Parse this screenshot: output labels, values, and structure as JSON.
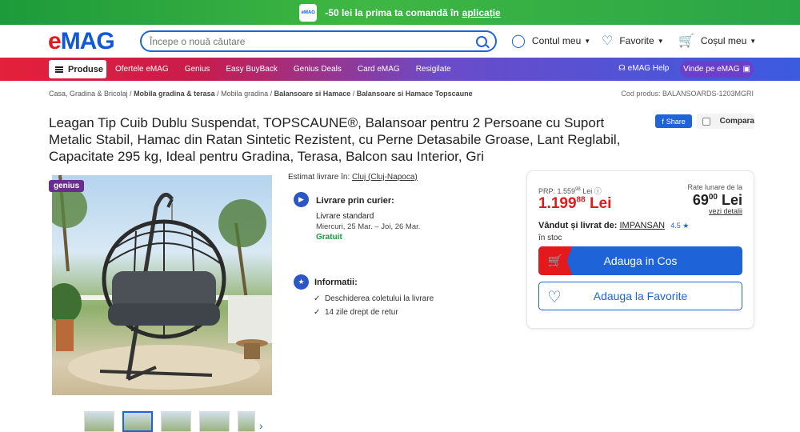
{
  "promo": {
    "text": "-50 lei la prima ta comandă în",
    "link": "aplicație",
    "icon": "emag-app-icon"
  },
  "header": {
    "logo_e": "e",
    "logo_mag": "MAG",
    "search_placeholder": "Începe o nouă căutare",
    "account": "Contul meu",
    "favorites": "Favorite",
    "cart": "Coșul meu"
  },
  "nav": {
    "produse": "Produse",
    "links": [
      "Ofertele eMAG",
      "Genius",
      "Easy BuyBack",
      "Genius Deals",
      "Card eMAG",
      "Resigilate"
    ],
    "help": "eMAG Help",
    "sell": "Vinde pe eMAG"
  },
  "breadcrumb": {
    "items": [
      "Casa, Gradina & Bricolaj",
      "Mobila gradina & terasa",
      "Mobila gradina",
      "Balansoare si Hamace",
      "Balansoare si Hamace Topscaune"
    ],
    "code": "Cod produs: BALANSOARDS-1203MGRI"
  },
  "product": {
    "title": "Leagan Tip Cuib Dublu Suspendat, TOPSCAUNE®, Balansoar pentru 2 Persoane cu Suport Metalic Stabil, Hamac din Ratan Sintetic Rezistent, cu Perne Detasabile Groase, Lant Reglabil, Capacitate 295 kg, Ideal pentru Gradina, Terasa, Balcon sau Interior, Gri",
    "share": "Share",
    "compare": "Compara",
    "badge": "genius"
  },
  "delivery": {
    "estimat_label": "Estimat livrare în:",
    "location": "Cluj (Cluj-Napoca)",
    "courier_title": "Livrare prin curier:",
    "standard": "Livrare standard",
    "dates": "Miercuri, 25 Mar. – Joi, 26 Mar.",
    "free": "Gratuit",
    "info_title": "Informatii:",
    "info_items": [
      "Deschiderea coletului la livrare",
      "14 zile drept de retur"
    ]
  },
  "buy": {
    "prp_label": "PRP: 1.559",
    "prp_dec": "98",
    "prp_cur": "Lei",
    "price_int": "1.199",
    "price_dec": "88",
    "price_cur": "Lei",
    "rate_label": "Rate lunare de la",
    "rate_int": "69",
    "rate_dec": "00",
    "rate_cur": "Lei",
    "rate_link": "vezi detalii",
    "sold_label": "Vândut și livrat de:",
    "seller": "IMPANSAN",
    "rating": "4.5",
    "stock": "în stoc",
    "cart_button": "Adauga in Cos",
    "fav_button": "Adauga la Favorite"
  },
  "colors": {
    "brand_red": "#e3191b",
    "brand_blue": "#1e63d8",
    "promo_green": "#2aa546",
    "genius_purple": "#6a2c91"
  }
}
